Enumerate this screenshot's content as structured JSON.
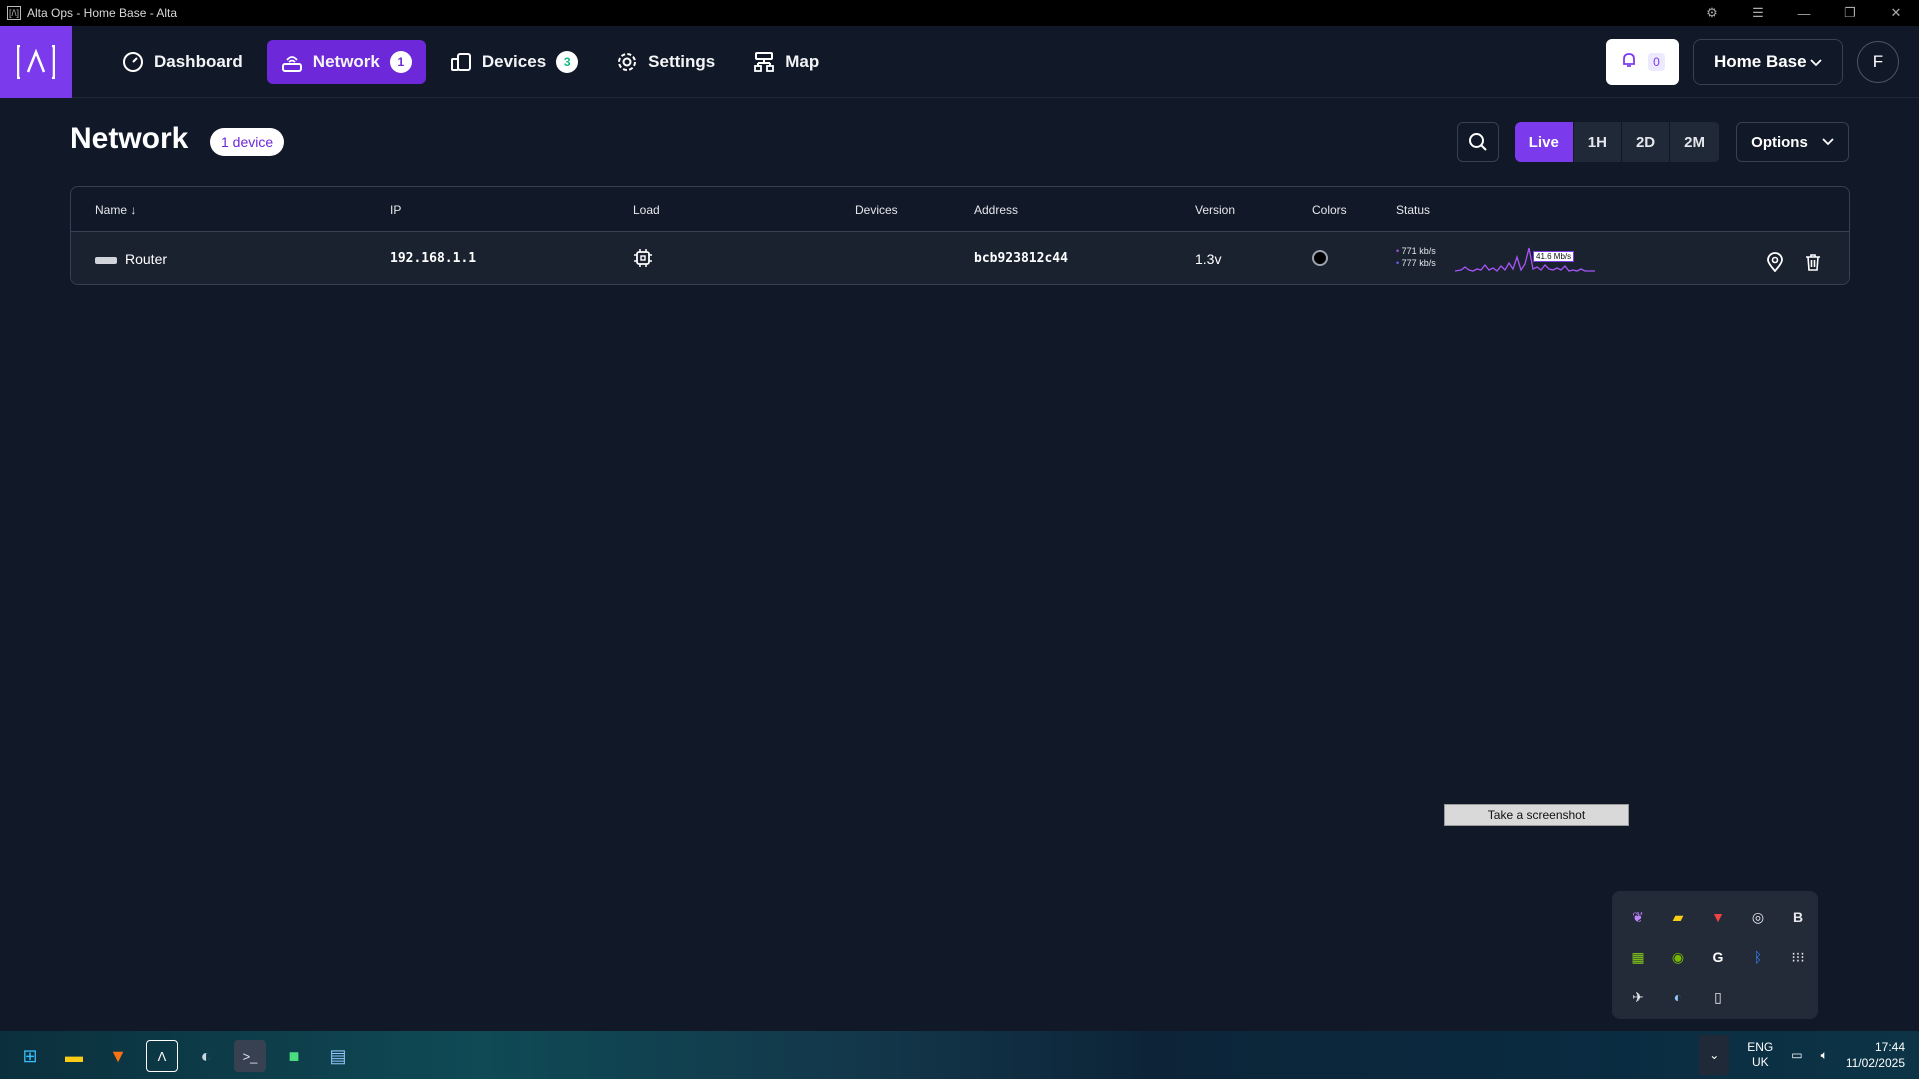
{
  "window": {
    "title": "Alta Ops - Home Base - Alta",
    "app_icon": "[/\\]"
  },
  "nav": [
    {
      "label": "Dashboard",
      "icon": "gauge-icon"
    },
    {
      "label": "Network",
      "icon": "router-icon",
      "badge": "1",
      "active": true
    },
    {
      "label": "Devices",
      "icon": "devices-icon",
      "badge": "3"
    },
    {
      "label": "Settings",
      "icon": "gear-icon"
    },
    {
      "label": "Map",
      "icon": "map-icon"
    }
  ],
  "header": {
    "notifications_count": "0",
    "site": "Home Base",
    "avatar": "F"
  },
  "page": {
    "title": "Network",
    "device_count": "1 device"
  },
  "toolbar": {
    "ranges": [
      "Live",
      "1H",
      "2D",
      "2M"
    ],
    "active_range": "Live",
    "options_label": "Options"
  },
  "table": {
    "columns": [
      "Name",
      "IP",
      "Load",
      "Devices",
      "Address",
      "Version",
      "Colors",
      "Status"
    ],
    "sort_indicator": "↓",
    "rows": [
      {
        "name": "Router",
        "ip": "192.168.1.1",
        "load_icon": "cpu-icon",
        "devices": "",
        "address": "bcb923812c44",
        "version": "1.3v",
        "color": "#000000",
        "rate_up": "771 kb/s",
        "rate_down": "777 kb/s",
        "peak": "41.6 Mb/s"
      }
    ]
  },
  "tooltip": "Take a screenshot",
  "tray_icons": [
    "feather-icon",
    "ticket-icon",
    "shield-icon",
    "copilot-icon",
    "b-icon",
    "grid-icon",
    "nvidia-icon",
    "g-icon",
    "bluetooth-icon",
    "dots-icon",
    "plane-icon",
    "steam-icon",
    "usb-icon"
  ],
  "taskbar": {
    "lang": "ENG",
    "region": "UK",
    "time": "17:44",
    "date": "11/02/2025"
  },
  "colors": {
    "accent": "#7c3aed",
    "active_nav": "#6d28d9",
    "bg": "#111827"
  }
}
